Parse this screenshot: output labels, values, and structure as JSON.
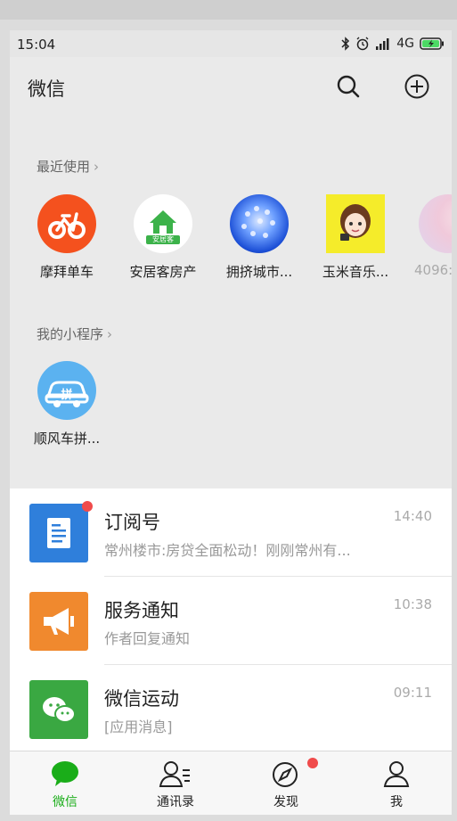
{
  "status": {
    "time": "15:04",
    "network": "4G"
  },
  "header": {
    "title": "微信"
  },
  "recent": {
    "title": "最近使用",
    "items": [
      {
        "label": "摩拜单车",
        "icon": "mobike-icon"
      },
      {
        "label": "安居客房产",
        "icon": "anjuke-icon",
        "icon_text": "安居客"
      },
      {
        "label": "拥挤城市...",
        "icon": "crowd-city-icon"
      },
      {
        "label": "玉米音乐...",
        "icon": "corn-music-icon"
      },
      {
        "label": "4096:",
        "icon": "4096-icon"
      }
    ]
  },
  "mine": {
    "title": "我的小程序",
    "items": [
      {
        "label": "顺风车拼...",
        "icon": "carpool-icon",
        "icon_text": "拼"
      }
    ]
  },
  "chats": [
    {
      "name": "订阅号",
      "preview": "常州楼市:房贷全面松动！刚刚常州有...",
      "time": "14:40",
      "icon": "subscription-icon",
      "color": "#2f7fdb"
    },
    {
      "name": "服务通知",
      "preview": "作者回复通知",
      "time": "10:38",
      "icon": "megaphone-icon",
      "color": "#f0892e"
    },
    {
      "name": "微信运动",
      "preview": "[应用消息]",
      "time": "09:11",
      "icon": "wechat-sport-icon",
      "color": "#3aa842"
    }
  ],
  "tabs": [
    {
      "label": "微信",
      "icon": "chat-bubble-icon"
    },
    {
      "label": "通讯录",
      "icon": "contacts-icon"
    },
    {
      "label": "发现",
      "icon": "compass-icon"
    },
    {
      "label": "我",
      "icon": "profile-icon"
    }
  ],
  "colors": {
    "accent": "#1aad19",
    "badge": "#f04b4b"
  }
}
